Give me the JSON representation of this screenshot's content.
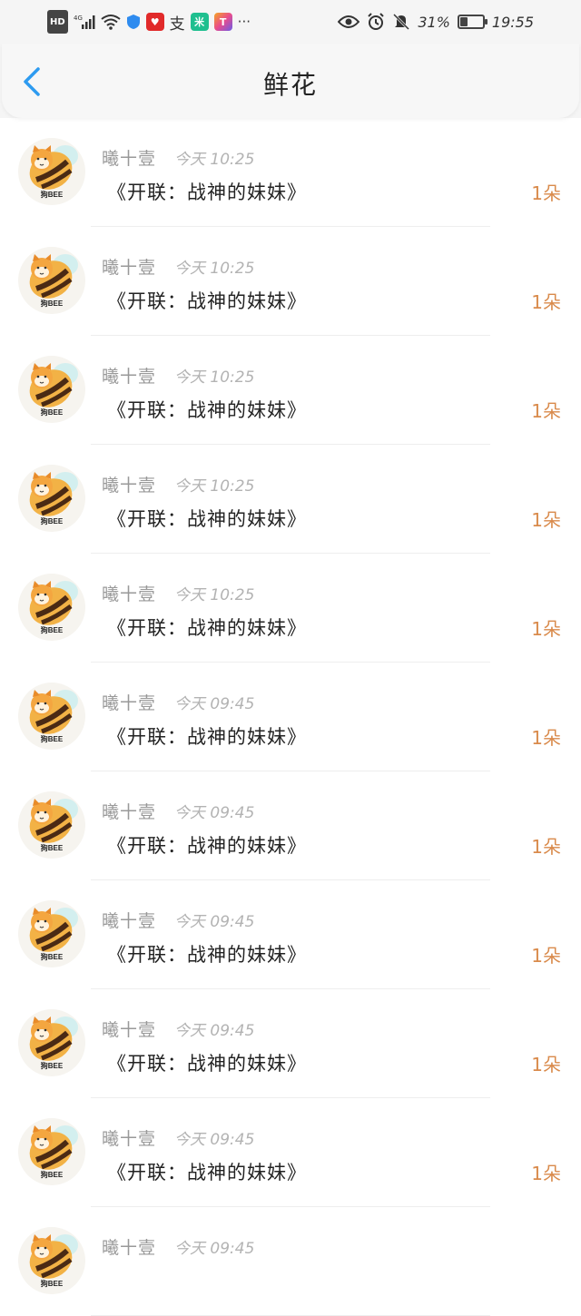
{
  "status_bar": {
    "hd": "HD",
    "network": "4G",
    "battery_text": "31%",
    "battery_level": 0.31,
    "time": "19:55",
    "more": "···",
    "app_icons": [
      "shield-icon",
      "heart-app-icon",
      "alipay-icon",
      "mi-app-icon",
      "colorful-app-icon"
    ]
  },
  "header": {
    "title": "鲜花",
    "back_icon": "chevron-left-icon",
    "accent_color": "#2e9bf0"
  },
  "list": {
    "items": [
      {
        "avatar_label": "狗BEE",
        "sender": "曦十壹",
        "time": "今天 10:25",
        "gift": "《开联：战神的妹妹》",
        "count": "1朵"
      },
      {
        "avatar_label": "狗BEE",
        "sender": "曦十壹",
        "time": "今天 10:25",
        "gift": "《开联：战神的妹妹》",
        "count": "1朵"
      },
      {
        "avatar_label": "狗BEE",
        "sender": "曦十壹",
        "time": "今天 10:25",
        "gift": "《开联：战神的妹妹》",
        "count": "1朵"
      },
      {
        "avatar_label": "狗BEE",
        "sender": "曦十壹",
        "time": "今天 10:25",
        "gift": "《开联：战神的妹妹》",
        "count": "1朵"
      },
      {
        "avatar_label": "狗BEE",
        "sender": "曦十壹",
        "time": "今天 10:25",
        "gift": "《开联：战神的妹妹》",
        "count": "1朵"
      },
      {
        "avatar_label": "狗BEE",
        "sender": "曦十壹",
        "time": "今天 09:45",
        "gift": "《开联：战神的妹妹》",
        "count": "1朵"
      },
      {
        "avatar_label": "狗BEE",
        "sender": "曦十壹",
        "time": "今天 09:45",
        "gift": "《开联：战神的妹妹》",
        "count": "1朵"
      },
      {
        "avatar_label": "狗BEE",
        "sender": "曦十壹",
        "time": "今天 09:45",
        "gift": "《开联：战神的妹妹》",
        "count": "1朵"
      },
      {
        "avatar_label": "狗BEE",
        "sender": "曦十壹",
        "time": "今天 09:45",
        "gift": "《开联：战神的妹妹》",
        "count": "1朵"
      },
      {
        "avatar_label": "狗BEE",
        "sender": "曦十壹",
        "time": "今天 09:45",
        "gift": "《开联：战神的妹妹》",
        "count": "1朵"
      },
      {
        "avatar_label": "狗BEE",
        "sender": "曦十壹",
        "time": "今天 09:45",
        "gift": "",
        "count": ""
      }
    ]
  },
  "colors": {
    "count": "#d98a4b",
    "sender": "#999999",
    "time": "#b3b3b3"
  }
}
